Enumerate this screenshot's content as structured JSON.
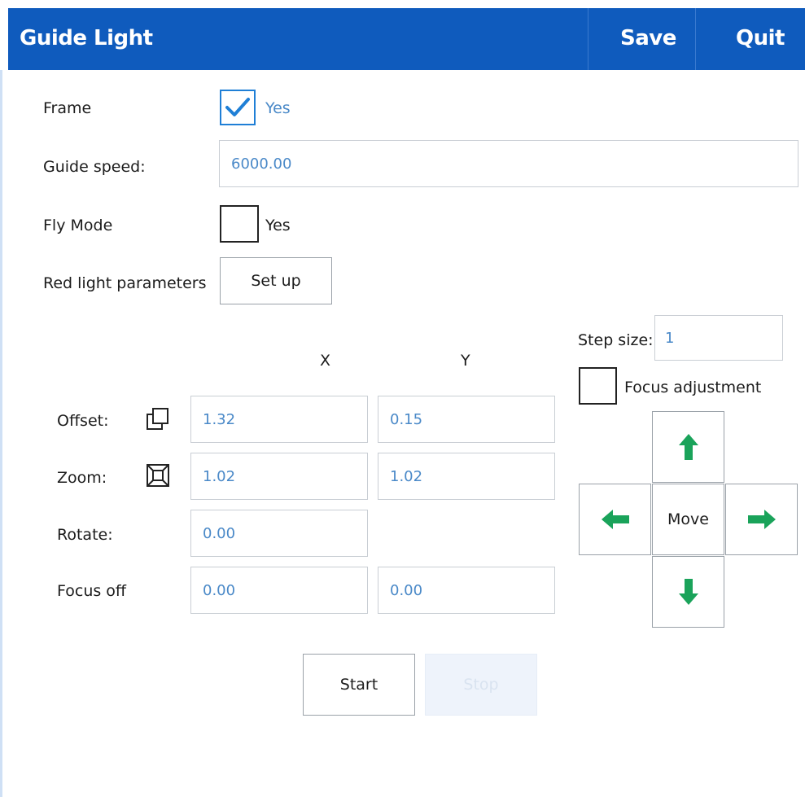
{
  "window": {
    "title": "Guide Light",
    "save_label": "Save",
    "quit_label": "Quit"
  },
  "form": {
    "frame": {
      "label": "Frame",
      "option": "Yes",
      "checked": true
    },
    "guide_speed": {
      "label": "Guide speed:",
      "value": "6000.00"
    },
    "fly_mode": {
      "label": "Fly Mode",
      "option": "Yes",
      "checked": false
    },
    "red_light": {
      "label": "Red light parameters",
      "button": "Set up"
    }
  },
  "grid": {
    "col_x": "X",
    "col_y": "Y",
    "offset": {
      "label": "Offset:",
      "x": "1.32",
      "y": "0.15",
      "icon": "offset-icon"
    },
    "zoom": {
      "label": "Zoom:",
      "x": "1.02",
      "y": "1.02",
      "icon": "zoom-icon"
    },
    "rotate": {
      "label": "Rotate:",
      "x": "0.00"
    },
    "focus_off": {
      "label": "Focus off",
      "x": "0.00",
      "y": "0.00"
    }
  },
  "move_panel": {
    "step_label": "Step size:",
    "step_value": "1",
    "focus_adjust_label": "Focus adjustment",
    "focus_adjust_checked": false,
    "move_label": "Move",
    "arrow_color": "#1aa35a"
  },
  "actions": {
    "start": "Start",
    "stop": "Stop"
  },
  "colors": {
    "titlebar": "#0f5bbd",
    "accent": "#1f7fd6",
    "value_text": "#4a89c8"
  }
}
